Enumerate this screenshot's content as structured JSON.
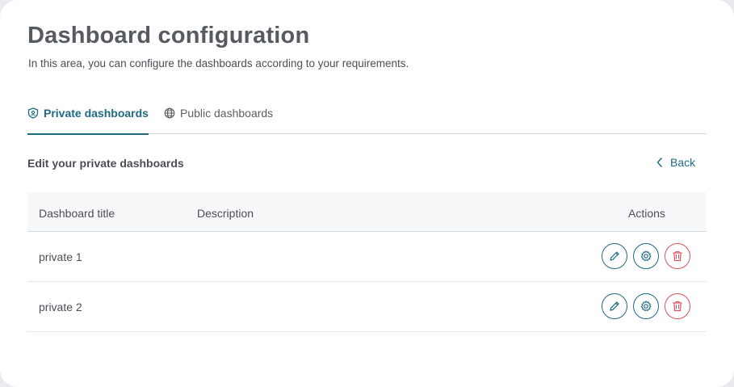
{
  "header": {
    "title": "Dashboard configuration",
    "subtitle": "In this area, you can configure the dashboards according to your requirements."
  },
  "tabs": [
    {
      "label": "Private dashboards",
      "icon": "shield-icon",
      "active": true
    },
    {
      "label": "Public dashboards",
      "icon": "globe-icon",
      "active": false
    }
  ],
  "section": {
    "title": "Edit your private dashboards",
    "back_label": "Back"
  },
  "table": {
    "columns": [
      "Dashboard title",
      "Description",
      "Actions"
    ],
    "rows": [
      {
        "title": "private 1",
        "description": ""
      },
      {
        "title": "private 2",
        "description": ""
      }
    ],
    "actions": [
      "pencil-icon",
      "gear-icon",
      "trash-icon"
    ]
  },
  "colors": {
    "accent": "#1d6a82",
    "danger": "#d9535d",
    "text": "#4a4f55"
  }
}
